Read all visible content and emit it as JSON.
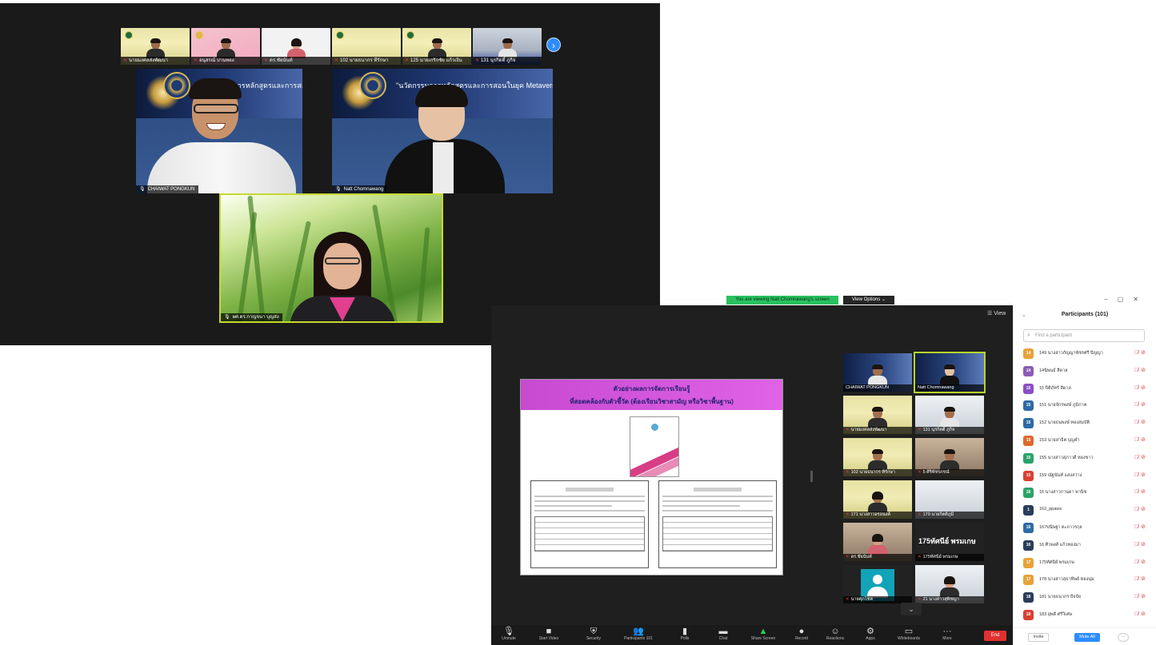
{
  "gallery": {
    "thumbnails": [
      {
        "name": "นายมงคลส่งพัฒนา",
        "bg": "banner"
      },
      {
        "name": "อนุสรณ์ ปานทอง",
        "bg": "pink"
      },
      {
        "name": "ดร.ชัยนันท์",
        "bg": "white"
      },
      {
        "name": "102 นายธนากร ทีรักษา",
        "bg": "banner"
      },
      {
        "name": "125 นายเกริกชัย แก้วเงิน",
        "bg": "banner"
      },
      {
        "name": "131 นุรกิตติ์ ภูกิจ",
        "bg": "office"
      }
    ],
    "next_icon": "chevron-right-icon",
    "speaker_left": {
      "name": "CHAIWAT PONGKUN",
      "slide_title": "\"นวัตกรรมการหลักสูตรและการสอนในยุค Metaverse\""
    },
    "speaker_right": {
      "name": "Natt Chomnawang",
      "slide_title": "\"นวัตกรรมการหลักสูตรและการสอนในยุค Metaverse\""
    },
    "speaker_bottom": {
      "name": "ผศ.ดร.กาญจนา บุญส่ง"
    }
  },
  "share": {
    "banner": "You are viewing Natt Chomnawang's screen",
    "view_options": "View Options ⌄",
    "view_label": "☰ View",
    "slide": {
      "line1": "ตัวอย่างผลการจัดการเรียนรู้",
      "line2": "ที่สอดคล้องกับตัวชี้วัด (ต้องเรียนวิชาสามัญ หรือวิชาพื้นฐาน)"
    },
    "video_tiles": [
      {
        "name": "CHAIWAT PONGKUN",
        "bg": "slide",
        "active": false
      },
      {
        "name": "Natt Chomnawang",
        "bg": "slide",
        "active": true
      },
      {
        "name": "นายมงคลส่งพัฒนา",
        "bg": "banner",
        "active": false
      },
      {
        "name": "131 นุรกิตติ์ ภูกิจ",
        "bg": "light",
        "active": false
      },
      {
        "name": "102 นายธนากร ทีรักษา",
        "bg": "banner",
        "active": false
      },
      {
        "name": "5 ศิริพัชรภรณ์",
        "bg": "room",
        "active": false
      },
      {
        "name": "171 นางสาวอรอนงค์",
        "bg": "banner",
        "active": false
      },
      {
        "name": "179 นายกิตติภูมิ",
        "bg": "light",
        "active": false
      },
      {
        "name": "ดร.ชัยนันท์",
        "bg": "room",
        "active": false
      },
      {
        "name": "175ทัศนีย์ พรมเกษ",
        "bg": "dark",
        "active": false,
        "big_text": "175ทัศนีย์ พรมเกษ"
      },
      {
        "name": "นายศุภโชค",
        "bg": "avatar",
        "active": false
      },
      {
        "name": "21 นางสาวสุพิชญา",
        "bg": "light",
        "active": false
      }
    ],
    "toolbar": [
      {
        "label": "Unmute",
        "icon": "🎙",
        "name": "unmute-button"
      },
      {
        "label": "Start Video",
        "icon": "■",
        "name": "start-video-button"
      },
      {
        "label": "Security",
        "icon": "⛨",
        "name": "security-button"
      },
      {
        "label": "Participants 101",
        "icon": "👥",
        "name": "participants-button"
      },
      {
        "label": "Polls",
        "icon": "▮",
        "name": "polls-button"
      },
      {
        "label": "Chat",
        "icon": "▬",
        "name": "chat-button"
      },
      {
        "label": "Share Screen",
        "icon": "▲",
        "name": "share-screen-button"
      },
      {
        "label": "Record",
        "icon": "●",
        "name": "record-button"
      },
      {
        "label": "Reactions",
        "icon": "☺",
        "name": "reactions-button"
      },
      {
        "label": "Apps",
        "icon": "⚙",
        "name": "apps-button"
      },
      {
        "label": "Whiteboards",
        "icon": "▭",
        "name": "whiteboards-button"
      },
      {
        "label": "More",
        "icon": "···",
        "name": "more-button"
      }
    ],
    "end_label": "End"
  },
  "participants": {
    "title": "Participants (101)",
    "search_placeholder": "Find a participant",
    "items": [
      {
        "initials": "14",
        "name": "149 นางสาวกัญญาพัชรศรี ปัญญา",
        "color": "#e8a23a"
      },
      {
        "initials": "14",
        "name": "14นิพนธ์ สีดาล",
        "color": "#8b5bb5"
      },
      {
        "initials": "15",
        "name": "15 ปิติภัทร์ สีดาล",
        "color": "#8b4fc4"
      },
      {
        "initials": "15",
        "name": "151 นายจักรพงษ์ ภูมิภาค",
        "color": "#2e6aa8"
      },
      {
        "initials": "15",
        "name": "152 นายธนพงษ์ ทองสมบัติ",
        "color": "#2e6aa8"
      },
      {
        "initials": "15",
        "name": "153 นายสาธิต บุญคำ",
        "color": "#e0692d"
      },
      {
        "initials": "15",
        "name": "155 นางสาวสุภาวดี ทองขาว",
        "color": "#2aa36a"
      },
      {
        "initials": "15",
        "name": "159 ณัฐนันท์ แสงสว่าง",
        "color": "#d94032"
      },
      {
        "initials": "16",
        "name": "16 นางสาวกานดา พานิช",
        "color": "#2aa36a"
      },
      {
        "initials": "1",
        "name": "162_ppaws",
        "color": "#2a3d5c"
      },
      {
        "initials": "16",
        "name": "167ขนิษฐา ตะถาวรกุล",
        "color": "#2e6aa8"
      },
      {
        "initials": "16",
        "name": "16 ศิวพงศ์ แก้วทองมา",
        "color": "#2a3d5c"
      },
      {
        "initials": "17",
        "name": "175ทัศนีย์ พรมเกษ",
        "color": "#e8a23a"
      },
      {
        "initials": "17",
        "name": "178 นางสาวสุธาทิพย์ ทองนุ่ม",
        "color": "#e8a23a"
      },
      {
        "initials": "18",
        "name": "181 นายธนากร ปัจจัย",
        "color": "#2a3d5c"
      },
      {
        "initials": "18",
        "name": "183 ยุพดี ศรีวิเศษ",
        "color": "#d94032"
      }
    ],
    "invite_label": "Invite",
    "mute_all_label": "Mute All",
    "more_label": "···"
  }
}
